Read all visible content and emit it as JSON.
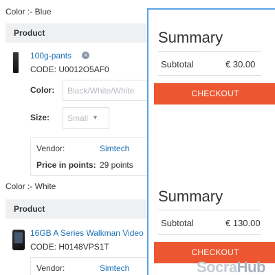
{
  "groups": [
    {
      "color_label": "Color :- Blue",
      "table_header": "Product",
      "product": {
        "name": "100g-pants",
        "code": "CODE: U0012O5AF0",
        "options": {
          "color_label": "Color:",
          "color_value": "Black/White/White",
          "size_label": "Size:",
          "size_value": "Small"
        },
        "vendor_label": "Vendor:",
        "vendor_value": "Simtech",
        "points_label": "Price in points:",
        "points_value": "29 points"
      },
      "summary": {
        "title": "Summary",
        "subtotal_label": "Subtotal",
        "subtotal_value": "€ 30.00",
        "checkout_label": "CHECKOUT"
      }
    },
    {
      "color_label": "Color :- White",
      "table_header": "Product",
      "product": {
        "name": "16GB A Series Walkman Video",
        "code": "CODE: H0148VPS1T",
        "vendor_label": "Vendor:",
        "vendor_value": "Simtech"
      },
      "summary": {
        "title": "Summary",
        "subtotal_label": "Subtotal",
        "subtotal_value": "€ 130.00",
        "checkout_label": "CHECKOUT"
      }
    }
  ],
  "watermark": {
    "part1": "Socra",
    "part2": "Hub"
  },
  "colors": {
    "accent": "#ec5732",
    "link": "#1a6fb5",
    "panel_border": "#5aa1e6"
  }
}
